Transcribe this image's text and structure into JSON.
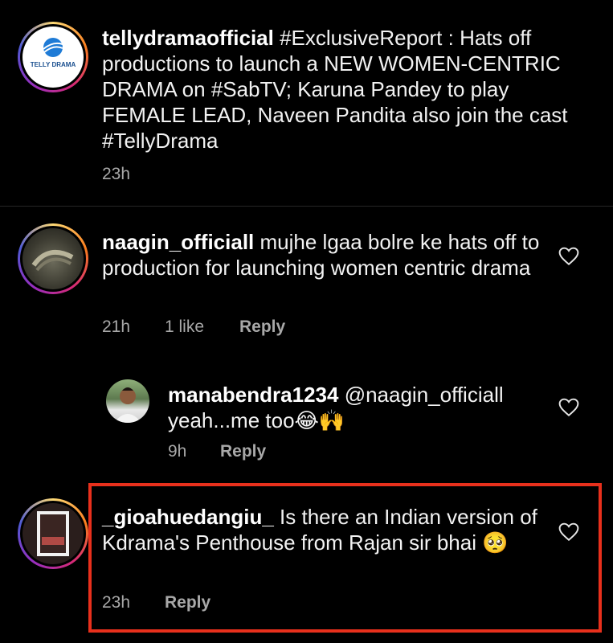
{
  "post": {
    "username": "tellydramaofficial",
    "caption": "#ExclusiveReport : Hats off productions to launch a NEW WOMEN-CENTRIC DRAMA on #SabTV; Karuna Pandey to play FEMALE LEAD, Naveen Pandita also join the cast #TellyDrama",
    "time": "23h",
    "avatar_text": "TELLY DRAMA"
  },
  "comments": [
    {
      "username": "naagin_officiall",
      "text": "mujhe lgaa bolre ke hats off to production for launching women centric drama",
      "time": "21h",
      "likes": "1 like",
      "reply_label": "Reply",
      "avatar_icon": "snake-photo"
    },
    {
      "username": "manabendra1234",
      "text": "@naagin_officiall yeah...me too",
      "emoji": "😂🙌",
      "time": "9h",
      "reply_label": "Reply",
      "avatar_icon": "person-photo"
    },
    {
      "username": "_gioahuedangiu_",
      "text": "Is there an Indian version of Kdrama's Penthouse from Rajan sir bhai",
      "emoji": "🥺",
      "time": "23h",
      "reply_label": "Reply",
      "avatar_icon": "photo"
    }
  ],
  "colors": {
    "highlight": "#e8301c",
    "meta": "#a8a8a8",
    "background": "#000000"
  }
}
